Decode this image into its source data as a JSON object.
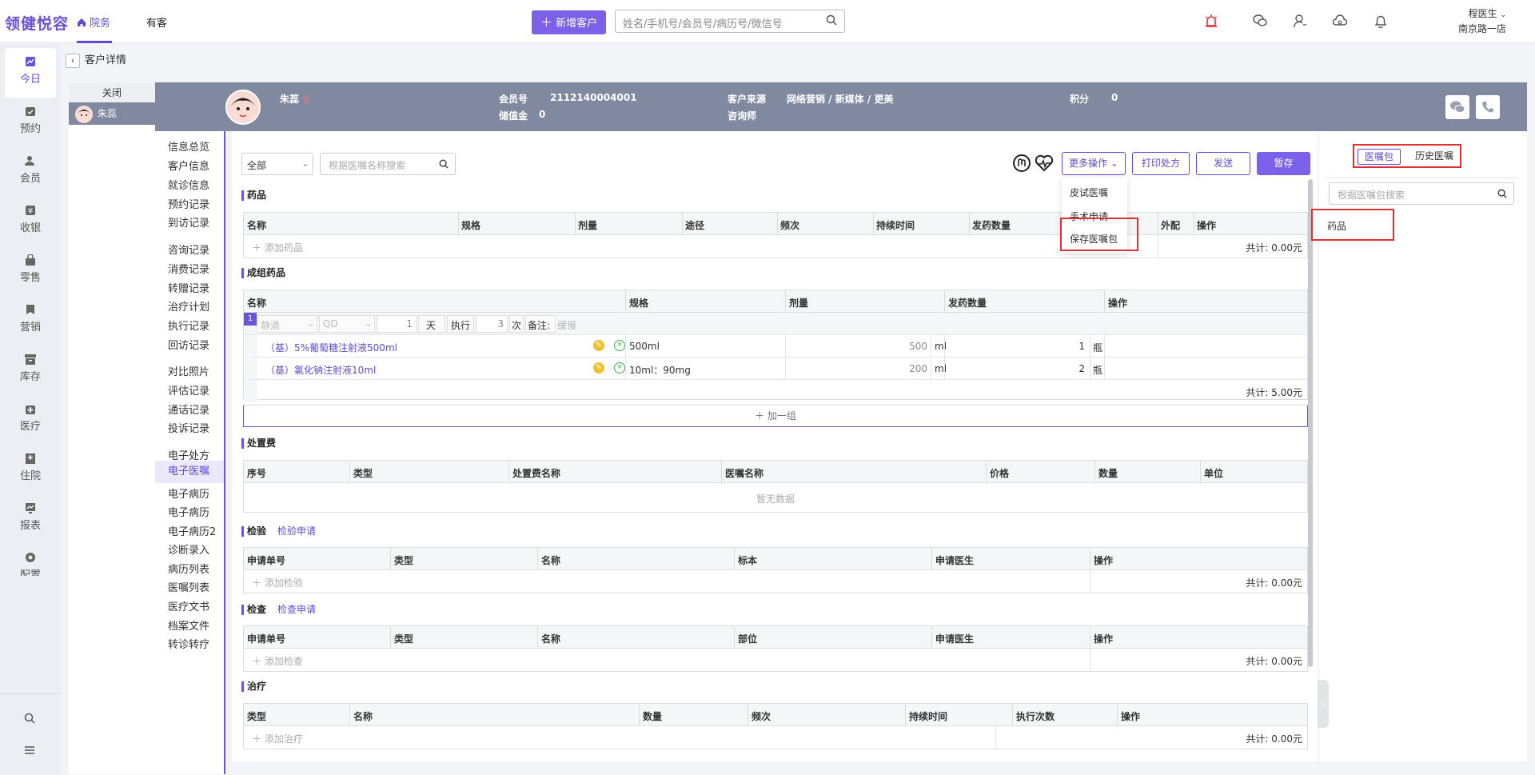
{
  "header": {
    "logo": "领健悦容",
    "nav": [
      {
        "label": "院务"
      },
      {
        "label": "有客"
      }
    ],
    "new_customer": "新增客户",
    "search_placeholder": "姓名/手机号/会员号/病历号/微信号",
    "user_name": "程医生",
    "user_store": "南京路一店"
  },
  "sidebar": {
    "items": [
      {
        "label": "今日",
        "icon": "chart-icon"
      },
      {
        "label": "预约",
        "icon": "calendar-icon"
      },
      {
        "label": "会员",
        "icon": "members-icon"
      },
      {
        "label": "收银",
        "icon": "cashier-icon"
      },
      {
        "label": "零售",
        "icon": "bag-icon"
      },
      {
        "label": "营销",
        "icon": "marketing-icon"
      },
      {
        "label": "库存",
        "icon": "inventory-icon"
      },
      {
        "label": "医疗",
        "icon": "medical-icon"
      },
      {
        "label": "住院",
        "icon": "hospital-icon"
      },
      {
        "label": "报表",
        "icon": "report-icon"
      },
      {
        "label": "配置",
        "icon": "config-icon"
      }
    ]
  },
  "breadcrumb": "客户详情",
  "patient_tabs": {
    "close": "关闭",
    "patient": "朱蕊"
  },
  "patient": {
    "name": "朱蕊",
    "member_label": "会员号",
    "member_no": "2112140004001",
    "stored_label": "储值金",
    "stored_value": "0",
    "source_label": "客户来源",
    "source_value": "网络营销 / 新媒体 / 更美",
    "consultant_label": "咨询师",
    "points_label": "积分",
    "points_value": "0"
  },
  "left_menu": [
    "信息总览",
    "客户信息",
    "就诊信息",
    "预约记录",
    "到访记录",
    "咨询记录",
    "消费记录",
    "转赠记录",
    "治疗计划",
    "执行记录",
    "回访记录",
    "对比照片",
    "评估记录",
    "通话记录",
    "投诉记录",
    "电子处方",
    "电子医嘱",
    "电子病历",
    "电子病历",
    "电子病历2",
    "诊断录入",
    "病历列表",
    "医嘱列表",
    "医疗文书",
    "档案文件",
    "转诊转疗"
  ],
  "toolbar": {
    "filter": "全部",
    "search_placeholder": "根据医嘱名称搜索",
    "more": "更多操作",
    "print": "打印处方",
    "send": "发送",
    "save": "暂存"
  },
  "dropdown": [
    "皮试医嘱",
    "手术申请",
    "保存医嘱包"
  ],
  "drugs": {
    "title": "药品",
    "headers": [
      "名称",
      "规格",
      "剂量",
      "途径",
      "频次",
      "持续时间",
      "发药数量",
      "外配",
      "操作"
    ],
    "add": "添加药品",
    "total": "共计: 0.00元"
  },
  "group_drugs": {
    "title": "成组药品",
    "headers": [
      "名称",
      "规格",
      "剂量",
      "发药数量",
      "操作"
    ],
    "group_no": "1",
    "route": "静滴",
    "freq": "QD",
    "days": "1",
    "days_unit": "天",
    "exec_label": "执行",
    "exec_count": "3",
    "exec_unit": "次",
    "note_label": "备注:",
    "note_value": "缓慢",
    "rows": [
      {
        "name": "（基）5%葡萄糖注射液500ml",
        "spec": "500ml",
        "dose": "500",
        "dose_unit": "ml",
        "qty": "1",
        "qty_unit": "瓶"
      },
      {
        "name": "（基）氯化钠注射液10ml",
        "spec": "10ml：90mg",
        "dose": "200",
        "dose_unit": "ml",
        "qty": "2",
        "qty_unit": "瓶"
      }
    ],
    "total": "共计: 5.00元",
    "add_group": "加一组"
  },
  "treatment_fee": {
    "title": "处置费",
    "headers": [
      "序号",
      "类型",
      "处置费名称",
      "医嘱名称",
      "价格",
      "数量",
      "单位"
    ],
    "empty": "暂无数据"
  },
  "lab": {
    "title": "检验",
    "link": "检验申请",
    "headers": [
      "申请单号",
      "类型",
      "名称",
      "标本",
      "申请医生",
      "操作"
    ],
    "add": "添加检验",
    "total": "共计: 0.00元"
  },
  "exam": {
    "title": "检查",
    "link": "检查申请",
    "headers": [
      "申请单号",
      "类型",
      "名称",
      "部位",
      "申请医生",
      "操作"
    ],
    "add": "添加检查",
    "total": "共计: 0.00元"
  },
  "therapy": {
    "title": "治疗",
    "headers": [
      "类型",
      "名称",
      "数量",
      "频次",
      "持续时间",
      "执行次数",
      "操作"
    ],
    "add": "添加治疗",
    "total": "共计: 0.00元"
  },
  "right_panel": {
    "tab_package": "医嘱包",
    "tab_history": "历史医嘱",
    "search_placeholder": "根据医嘱包搜索",
    "item": "药品"
  },
  "colors": {
    "accent": "#7b61ea",
    "highlight": "#e23030",
    "patient_bar": "#8189a1"
  }
}
